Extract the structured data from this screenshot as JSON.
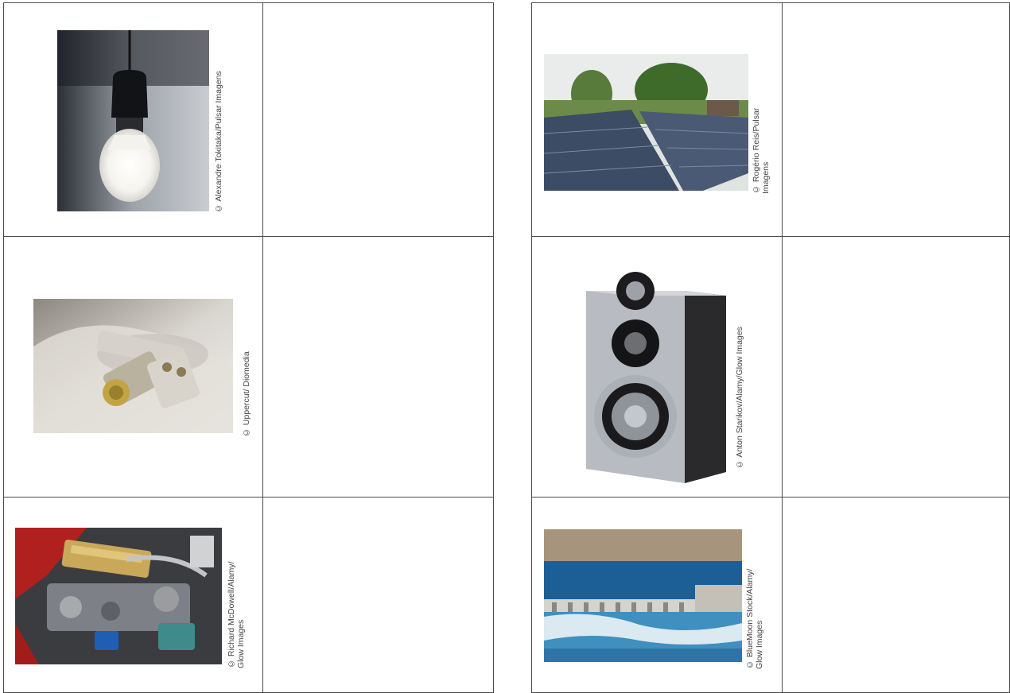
{
  "left_table": {
    "rows": [
      {
        "subject": "light-bulb",
        "credit": "© Alexandre Tokitaka/Pulsar Imagens",
        "answer": ""
      },
      {
        "subject": "batteries",
        "credit": "© Uppercut/ Diomedia",
        "answer": ""
      },
      {
        "subject": "car-engine",
        "credit": "© Richard McDowell/Alamy/\nGlow Images",
        "answer": ""
      }
    ]
  },
  "right_table": {
    "rows": [
      {
        "subject": "solar-panels",
        "credit": "© Rogério Reis/Pulsar\nImagens",
        "answer": ""
      },
      {
        "subject": "speaker",
        "credit": "© Anton Starikov/Alamy/Glow Images",
        "answer": ""
      },
      {
        "subject": "hydroelectric-dam",
        "credit": "© BlueMoon Stock/Alamy/\nGlow Images",
        "answer": ""
      }
    ]
  }
}
